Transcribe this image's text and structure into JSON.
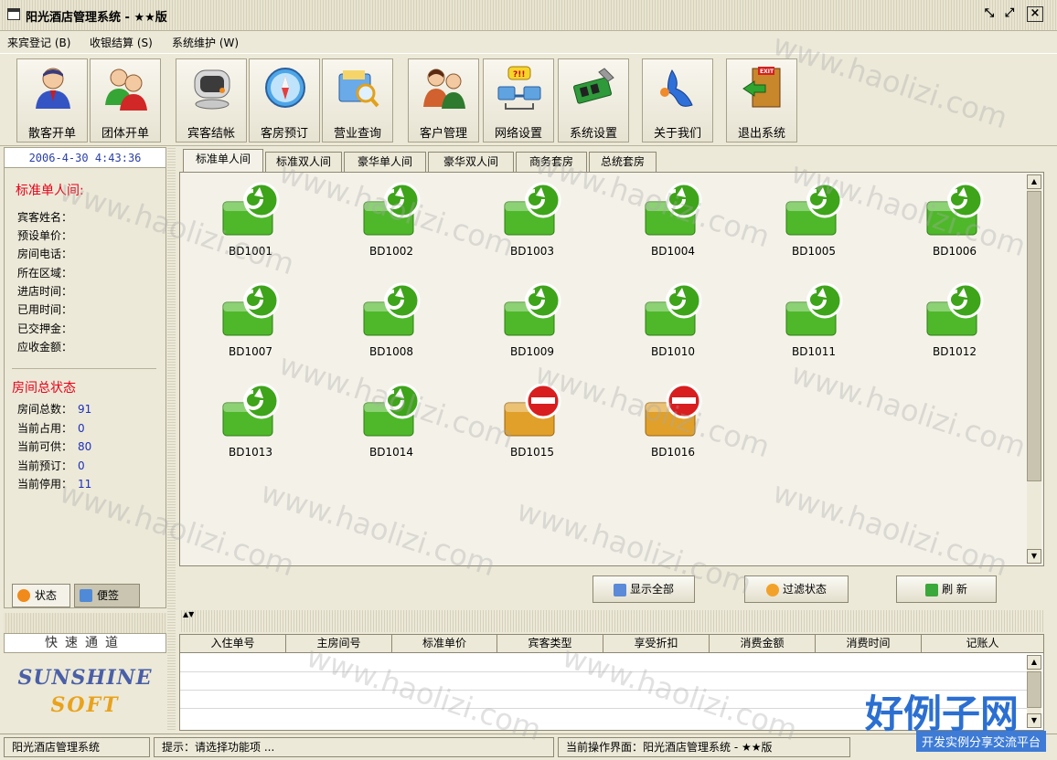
{
  "window": {
    "title": "阳光酒店管理系统 - ★★版"
  },
  "menu": [
    "来宾登记 (B)",
    "收银结算 (S)",
    "系统维护 (W)"
  ],
  "toolbar": [
    {
      "label": "散客开单",
      "icon": "single-guest-icon"
    },
    {
      "label": "团体开单",
      "icon": "group-guest-icon"
    },
    {
      "label": "宾客结帐",
      "icon": "checkout-icon"
    },
    {
      "label": "客房预订",
      "icon": "booking-icon"
    },
    {
      "label": "营业查询",
      "icon": "query-icon"
    },
    {
      "label": "客户管理",
      "icon": "customer-icon"
    },
    {
      "label": "网络设置",
      "icon": "network-icon"
    },
    {
      "label": "系统设置",
      "icon": "settings-icon"
    },
    {
      "label": "关于我们",
      "icon": "about-icon"
    },
    {
      "label": "退出系统",
      "icon": "exit-icon"
    }
  ],
  "clock": "2006-4-30  4:43:36",
  "room_info": {
    "title": "标准单人间:",
    "fields": [
      "宾客姓名：",
      "预设单价：",
      "房间电话：",
      "所在区域：",
      "进店时间：",
      "已用时间：",
      "已交押金：",
      "应收金额："
    ]
  },
  "room_status": {
    "title": "房间总状态",
    "items": [
      {
        "label": "房间总数：",
        "value": "91"
      },
      {
        "label": "当前占用：",
        "value": "0"
      },
      {
        "label": "当前可供：",
        "value": "80"
      },
      {
        "label": "当前预订：",
        "value": "0"
      },
      {
        "label": "当前停用：",
        "value": "11"
      }
    ]
  },
  "left_tabs": [
    "状态",
    "便签"
  ],
  "quick": {
    "label": "快速通道",
    "logo_line1": "SUNSHINE",
    "logo_line2": "SOFT"
  },
  "room_tabs": [
    "标准单人间",
    "标准双人间",
    "豪华单人间",
    "豪华双人间",
    "商务套房",
    "总统套房"
  ],
  "rooms": [
    {
      "id": "BD1001",
      "status": "available"
    },
    {
      "id": "BD1002",
      "status": "available"
    },
    {
      "id": "BD1003",
      "status": "available"
    },
    {
      "id": "BD1004",
      "status": "available"
    },
    {
      "id": "BD1005",
      "status": "available"
    },
    {
      "id": "BD1006",
      "status": "available"
    },
    {
      "id": "BD1007",
      "status": "available"
    },
    {
      "id": "BD1008",
      "status": "available"
    },
    {
      "id": "BD1009",
      "status": "available"
    },
    {
      "id": "BD1010",
      "status": "available"
    },
    {
      "id": "BD1011",
      "status": "available"
    },
    {
      "id": "BD1012",
      "status": "available"
    },
    {
      "id": "BD1013",
      "status": "available"
    },
    {
      "id": "BD1014",
      "status": "available"
    },
    {
      "id": "BD1015",
      "status": "disabled"
    },
    {
      "id": "BD1016",
      "status": "disabled"
    }
  ],
  "actions": [
    "显示全部",
    "过滤状态",
    "刷 新"
  ],
  "table_headers": [
    "入住单号",
    "主房间号",
    "标准单价",
    "宾客类型",
    "享受折扣",
    "消费金额",
    "消费时间",
    "记账人"
  ],
  "status": {
    "app": "阳光酒店管理系统",
    "hint": "提示：请选择功能项 ...",
    "current": "当前操作界面：阳光酒店管理系统 - ★★版"
  },
  "watermark": {
    "text": "www.haolizi.com",
    "brand": "好例子网",
    "brand_sub": "开发实例分享交流平台"
  }
}
